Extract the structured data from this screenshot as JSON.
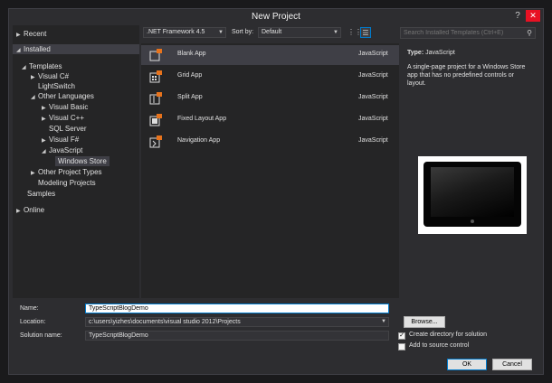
{
  "window": {
    "title": "New Project",
    "help_glyph": "?",
    "close_glyph": "✕"
  },
  "tree": {
    "items": [
      {
        "label": "Recent",
        "arrow": "▶"
      },
      {
        "label": "Installed",
        "arrow": "◢"
      },
      {
        "label": "Templates",
        "arrow": "◢"
      },
      {
        "label": "Visual C#",
        "arrow": "▶"
      },
      {
        "label": "LightSwitch",
        "arrow": ""
      },
      {
        "label": "Other Languages",
        "arrow": "◢"
      },
      {
        "label": "Visual Basic",
        "arrow": "▶"
      },
      {
        "label": "Visual C++",
        "arrow": "▶"
      },
      {
        "label": "SQL Server",
        "arrow": ""
      },
      {
        "label": "Visual F#",
        "arrow": "▶"
      },
      {
        "label": "JavaScript",
        "arrow": "◢"
      },
      {
        "label": "Windows Store",
        "arrow": ""
      },
      {
        "label": "Other Project Types",
        "arrow": "▶"
      },
      {
        "label": "Modeling Projects",
        "arrow": ""
      },
      {
        "label": "Samples",
        "arrow": ""
      },
      {
        "label": "Online",
        "arrow": "▶"
      }
    ]
  },
  "toolbar": {
    "framework": ".NET Framework 4.5",
    "sort_label": "Sort by:",
    "sort_value": "Default",
    "search_placeholder": "Search Installed Templates (Ctrl+E)"
  },
  "templates": [
    {
      "name": "Blank App",
      "language": "JavaScript"
    },
    {
      "name": "Grid App",
      "language": "JavaScript"
    },
    {
      "name": "Split App",
      "language": "JavaScript"
    },
    {
      "name": "Fixed Layout App",
      "language": "JavaScript"
    },
    {
      "name": "Navigation App",
      "language": "JavaScript"
    }
  ],
  "details": {
    "type_label": "Type:",
    "type_value": "JavaScript",
    "description": "A single-page project for a Windows Store app that has no predefined controls or layout."
  },
  "form": {
    "name_label": "Name:",
    "name_value": "TypeScriptBlogDemo",
    "location_label": "Location:",
    "location_value": "c:\\users\\yizhes\\documents\\visual studio 2012\\Projects",
    "solution_label": "Solution name:",
    "solution_value": "TypeScriptBlogDemo",
    "browse_label": "Browse...",
    "create_dir_label": "Create directory for solution",
    "create_dir_checked": true,
    "source_control_label": "Add to source control",
    "source_control_checked": false,
    "ok_label": "OK",
    "cancel_label": "Cancel"
  },
  "colors": {
    "accent": "#007acc",
    "dialog_bg": "#2d2d30",
    "panel_bg": "#252526",
    "selection": "#3f3f46",
    "js_badge": "#e8731c"
  }
}
